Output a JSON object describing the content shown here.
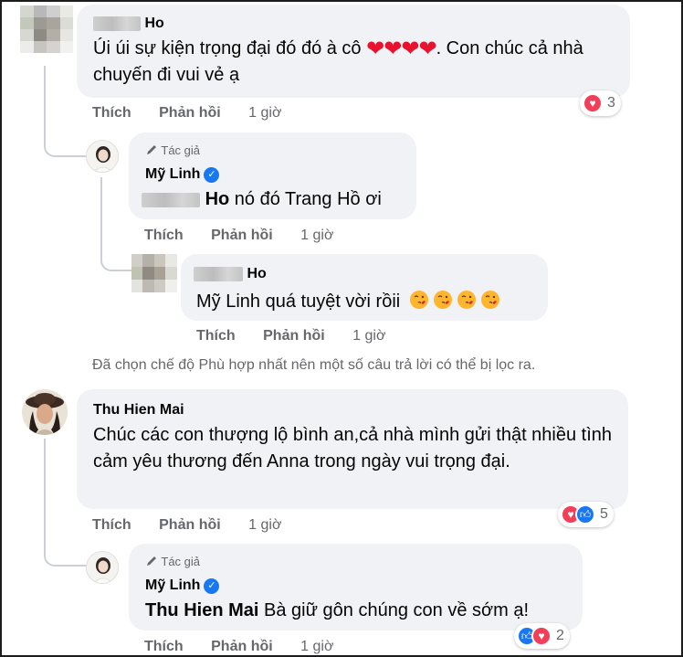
{
  "comments": {
    "c1": {
      "name_suffix": "Ho",
      "text_before": "Úi úi sự kiện trọng đại đó đó à cô",
      "hearts": "❤❤❤❤",
      "text_after": ". Con chúc cả nhà chuyến đi vui vẻ ạ",
      "reaction_count": "3",
      "like": "Thích",
      "reply": "Phản hồi",
      "time": "1 giờ"
    },
    "c1_reply1": {
      "badge": "Tác giả",
      "name": "Mỹ Linh",
      "mention": "Ho",
      "text": "nó đó Trang Hồ ơi",
      "like": "Thích",
      "reply": "Phản hồi",
      "time": "1 giờ"
    },
    "c1_reply2": {
      "name_suffix": "Ho",
      "text": "Mỹ Linh quá tuyệt vời rồii",
      "like": "Thích",
      "reply": "Phản hồi",
      "time": "1 giờ"
    },
    "notice": "Đã chọn chế độ Phù hợp nhất nên một số câu trả lời có thể bị lọc ra.",
    "c2": {
      "name": "Thu Hien Mai",
      "text": "Chúc các con thượng lộ bình an,cả nhà mình gửi thật nhiều tình cảm yêu thương đến Anna trong ngày vui trọng đại.",
      "reaction_count": "5",
      "like": "Thích",
      "reply": "Phản hồi",
      "time": "1 giờ"
    },
    "c2_reply1": {
      "badge": "Tác giả",
      "name": "Mỹ Linh",
      "mention": "Thu Hien Mai",
      "text": "Bà giữ gôn chúng con về sớm ạ!",
      "reaction_count": "2",
      "like": "Thích",
      "reply": "Phản hồi",
      "time": "1 giờ"
    }
  },
  "icons": {
    "love": "love-reaction-icon",
    "like": "like-reaction-icon",
    "verified": "verified-badge-icon",
    "pen": "author-pen-icon",
    "kiss": "face-blowing-kiss-emoji"
  },
  "colors": {
    "bubble": "#f0f2f5",
    "secondary_text": "#65676b",
    "love": "#f33e58",
    "like": "#1877f2"
  }
}
